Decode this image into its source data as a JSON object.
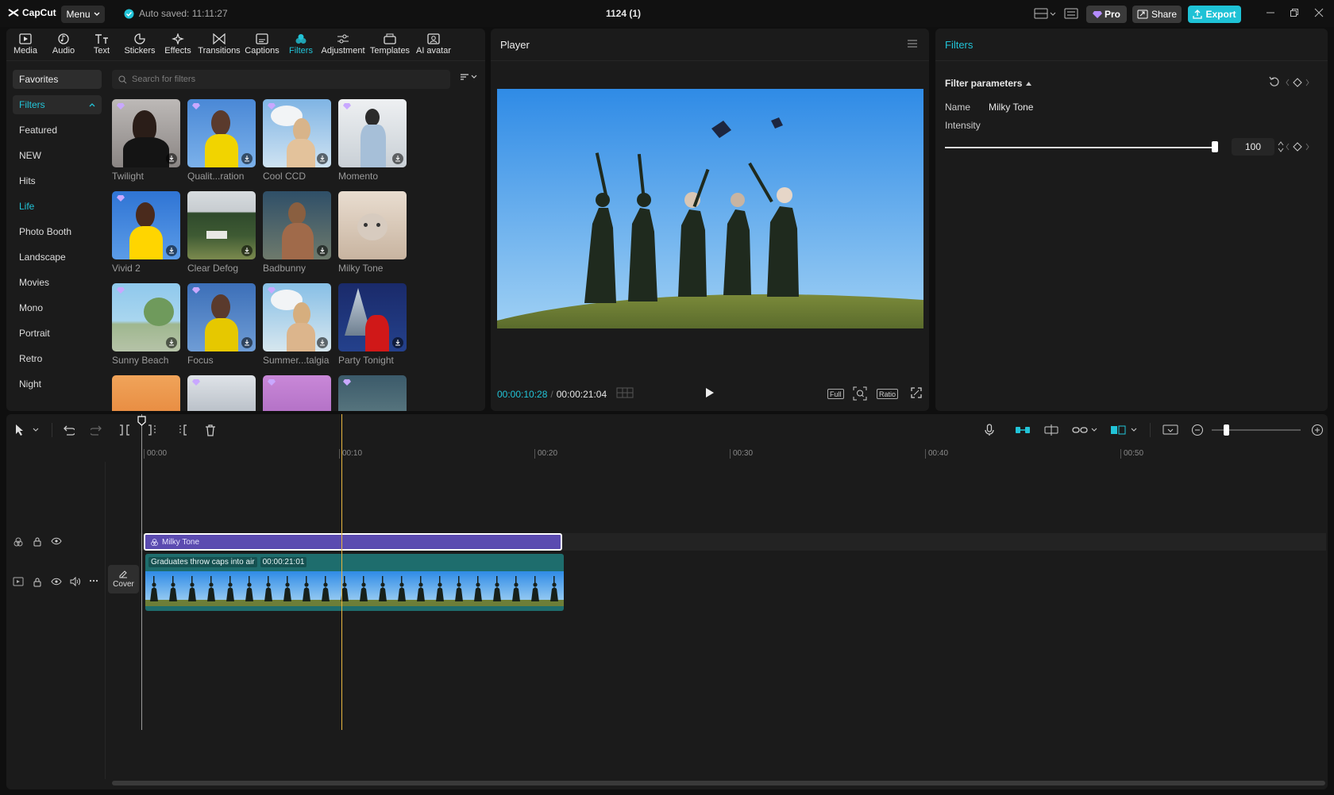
{
  "app": {
    "logo": "CapCut",
    "menu_label": "Menu",
    "autosave": "Auto saved: 11:11:27",
    "project_title": "1124 (1)",
    "pro_label": "Pro",
    "share_label": "Share",
    "export_label": "Export"
  },
  "toolbar": {
    "tabs": [
      "Media",
      "Audio",
      "Text",
      "Stickers",
      "Effects",
      "Transitions",
      "Captions",
      "Filters",
      "Adjustment",
      "Templates",
      "AI avatar"
    ],
    "active": "Filters"
  },
  "categories": [
    "Favorites",
    "Filters",
    "Featured",
    "NEW",
    "Hits",
    "Life",
    "Photo Booth",
    "Landscape",
    "Movies",
    "Mono",
    "Portrait",
    "Retro",
    "Night"
  ],
  "search": {
    "placeholder": "Search for filters"
  },
  "filters": [
    {
      "name": "Twilight"
    },
    {
      "name": "Qualit...ration"
    },
    {
      "name": "Cool CCD"
    },
    {
      "name": "Momento"
    },
    {
      "name": "Vivid 2"
    },
    {
      "name": "Clear Defog"
    },
    {
      "name": "Badbunny"
    },
    {
      "name": "Milky Tone"
    },
    {
      "name": "Sunny Beach"
    },
    {
      "name": "Focus"
    },
    {
      "name": "Summer...talgia"
    },
    {
      "name": "Party Tonight"
    }
  ],
  "player": {
    "title": "Player",
    "current_time": "00:00:10:28",
    "total_time": "00:00:21:04",
    "full_label": "Full",
    "ratio_label": "Ratio"
  },
  "inspector": {
    "title": "Filters",
    "section": "Filter parameters",
    "name_label": "Name",
    "name_value": "Milky Tone",
    "intensity_label": "Intensity",
    "intensity_value": "100",
    "intensity_fraction": 1.0
  },
  "timeline": {
    "ruler": [
      "00:00",
      "00:10",
      "00:20",
      "00:30",
      "00:40",
      "00:50"
    ],
    "filter_clip": "Milky Tone",
    "video_clip_title": "Graduates throw caps into air",
    "video_clip_duration": "00:00:21:01",
    "cover_label": "Cover"
  },
  "colors": {
    "accent": "#22c4d8",
    "filter_clip": "#5b4bb0",
    "video_clip": "#1e6d6d",
    "playhead": "#e8b640"
  }
}
